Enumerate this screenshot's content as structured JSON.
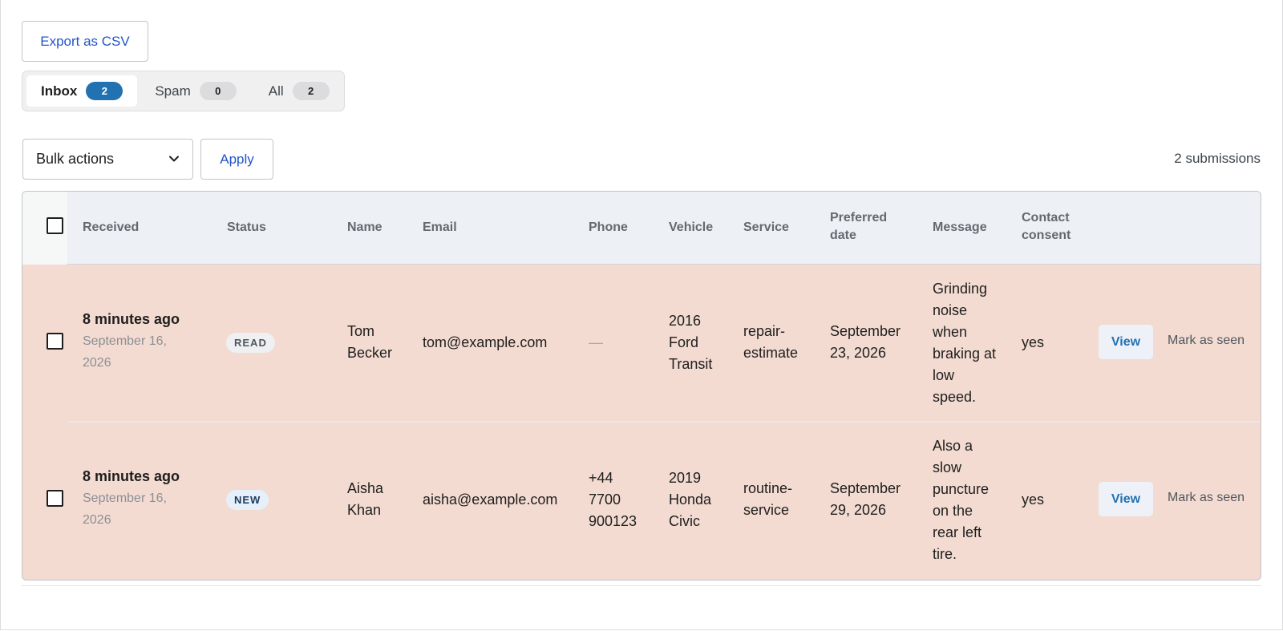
{
  "toolbar": {
    "export_label": "Export as CSV",
    "bulk_actions_label": "Bulk actions",
    "apply_label": "Apply",
    "submissions_count": "2 submissions"
  },
  "tabs": [
    {
      "label": "Inbox",
      "count": "2",
      "active": true
    },
    {
      "label": "Spam",
      "count": "0",
      "active": false
    },
    {
      "label": "All",
      "count": "2",
      "active": false
    }
  ],
  "table": {
    "headers": {
      "received": "Received",
      "status": "Status",
      "name": "Name",
      "email": "Email",
      "phone": "Phone",
      "vehicle": "Vehicle",
      "service": "Service",
      "preferred_date": "Preferred date",
      "message": "Message",
      "contact_consent": "Contact consent"
    },
    "rows": [
      {
        "received_relative": "8 minutes ago",
        "received_date": "September 16, 2026",
        "status": "READ",
        "name": "Tom Becker",
        "email": "tom@example.com",
        "phone": "—",
        "vehicle": "2016 Ford Transit",
        "service": "repair-estimate",
        "preferred_date": "September 23, 2026",
        "message": "Grinding noise when braking at low speed.",
        "consent": "yes",
        "view_label": "View",
        "mark_label": "Mark as seen"
      },
      {
        "received_relative": "8 minutes ago",
        "received_date": "September 16, 2026",
        "status": "NEW",
        "name": "Aisha Khan",
        "email": "aisha@example.com",
        "phone": "+44 7700 900123",
        "vehicle": "2019 Honda Civic",
        "service": "routine-service",
        "preferred_date": "September 29, 2026",
        "message": "Also a slow puncture on the rear left tire.",
        "consent": "yes",
        "view_label": "View",
        "mark_label": "Mark as seen"
      }
    ]
  },
  "colors": {
    "accent": "#2271b1",
    "row_highlight": "#f3dbd1",
    "header_bg": "#edf1f6"
  }
}
